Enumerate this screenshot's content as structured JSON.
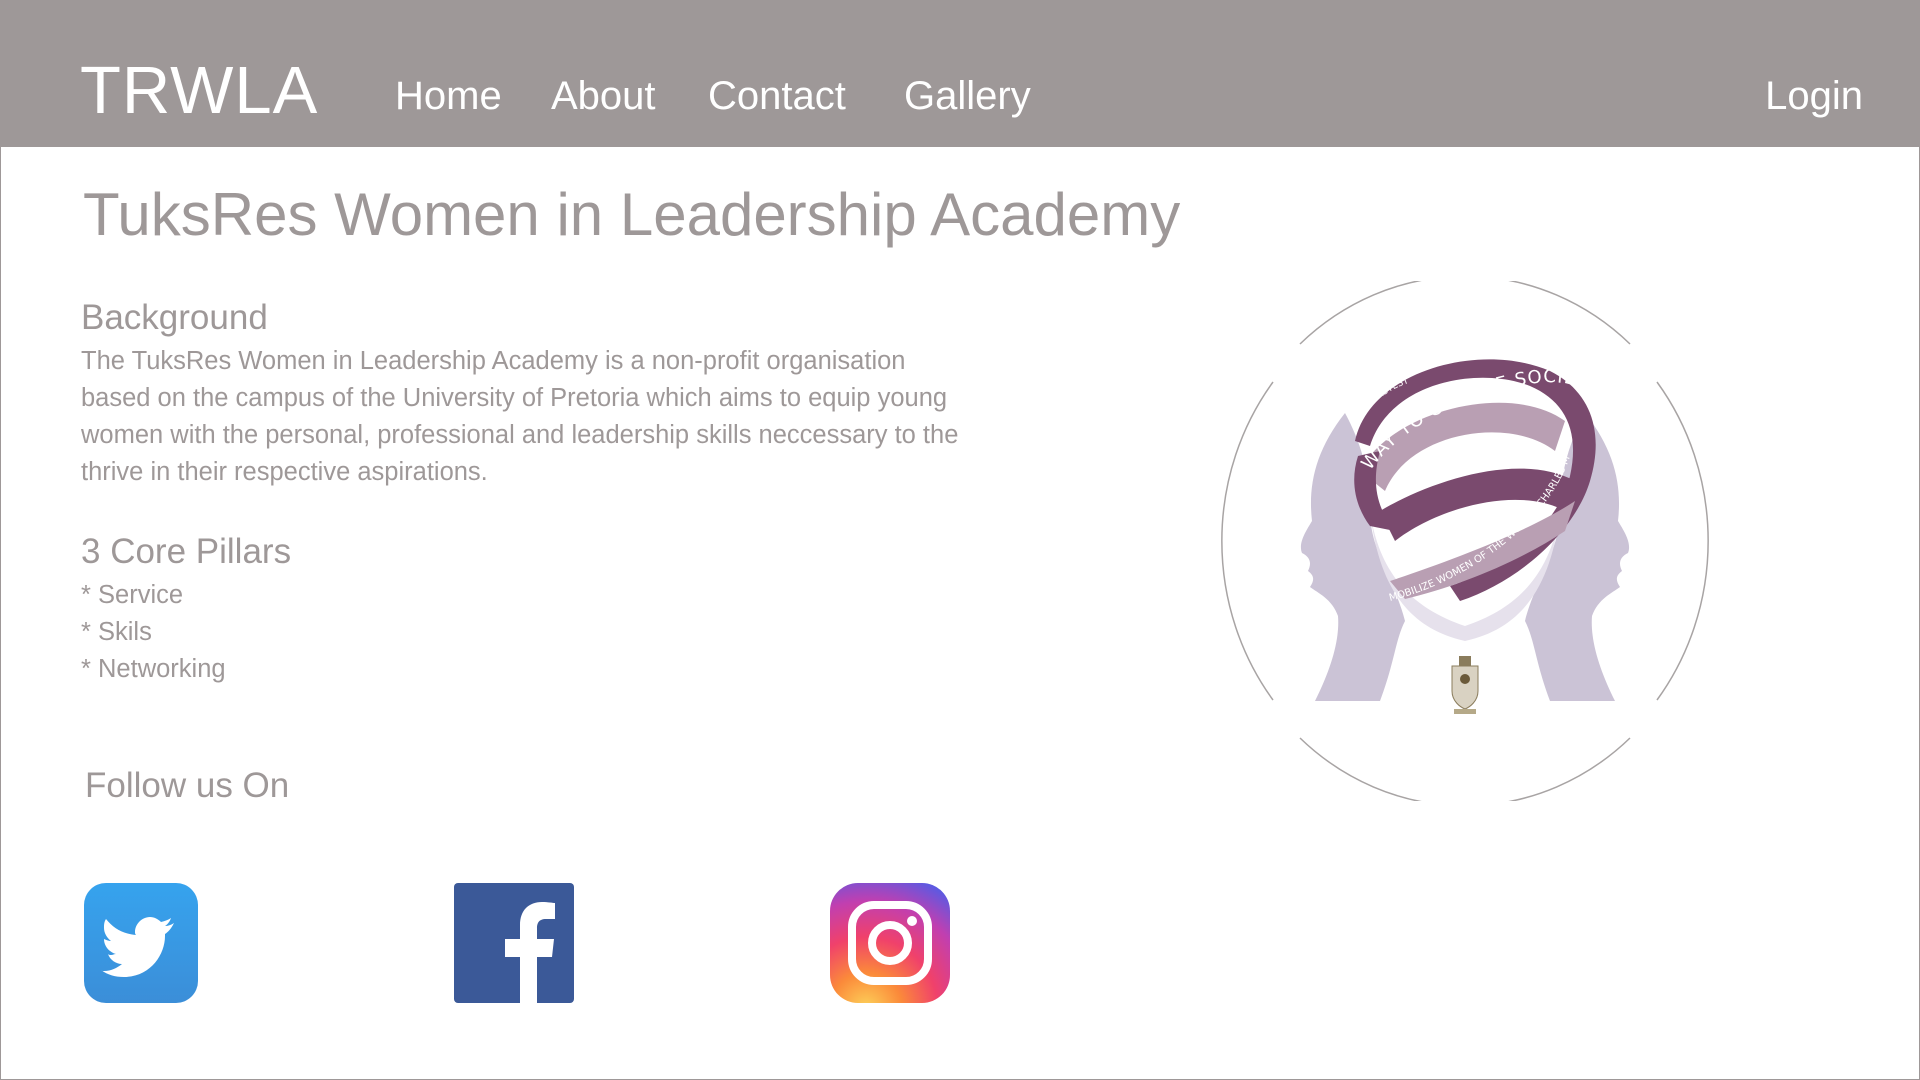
{
  "header": {
    "brand": "TRWLA",
    "nav": {
      "home": "Home",
      "about": "About",
      "contact": "Contact",
      "gallery": "Gallery"
    },
    "login": "Login",
    "background_color": "#9e9898"
  },
  "main": {
    "title": "TuksRes Women in Leadership Academy",
    "background": {
      "heading": "Background",
      "text": "The TuksRes Women in Leadership Academy is a non-profit organisation based on the campus of the University of Pretoria which aims to equip young women with the personal, professional and leadership skills neccessary to the thrive in their respective aspirations."
    },
    "pillars": {
      "heading": "3 Core Pillars",
      "items": [
        "* Service",
        "* Skils",
        "* Networking"
      ]
    },
    "follow": {
      "heading": "Follow us On"
    },
    "text_color": "#9e9898"
  },
  "logo": {
    "ribbon_text": "WAY TO CHANGE SOCIETY IS TO",
    "ribbon_inner_text": "MOBILIZE WOMEN OF THE WORLD\" CHARLES MALIK",
    "ribbon_tail_text": "\"THE FASTEST",
    "colors": {
      "ribbon": "#7a4a6e",
      "silhouettes": "#cbc3d6"
    }
  },
  "social": {
    "icons": [
      "twitter-icon",
      "facebook-icon",
      "instagram-icon"
    ],
    "colors": {
      "twitter": "#3f9ce0",
      "facebook": "#3b5998"
    }
  }
}
